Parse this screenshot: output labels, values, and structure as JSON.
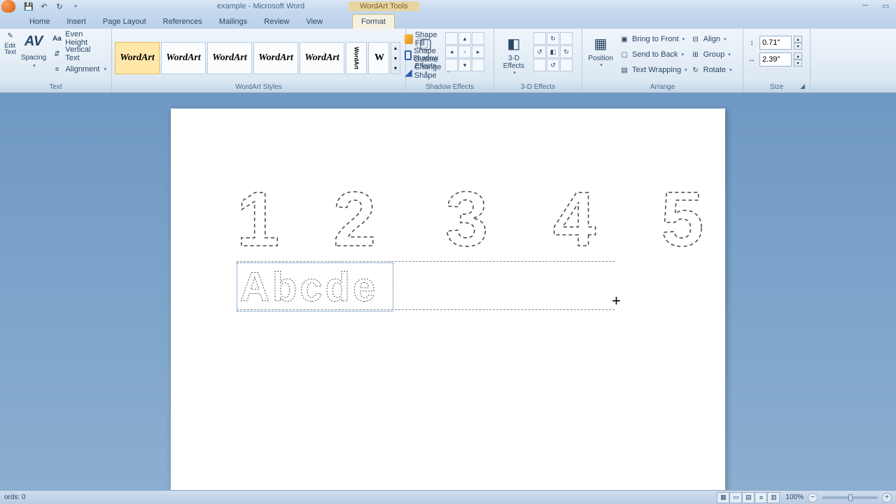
{
  "title": "example - Microsoft Word",
  "context_tab": "WordArt Tools",
  "tabs": [
    "Home",
    "Insert",
    "Page Layout",
    "References",
    "Mailings",
    "Review",
    "View",
    "Format"
  ],
  "ribbon": {
    "text": {
      "label": "Text",
      "edit": "Edit Text",
      "spacing": "Spacing",
      "even_height": "Even Height",
      "vertical_text": "Vertical Text",
      "alignment": "Alignment"
    },
    "styles": {
      "label": "WordArt Styles",
      "gallery": [
        "WordArt",
        "WordArt",
        "WordArt",
        "WordArt",
        "WordArt"
      ],
      "narrow": [
        "W",
        "W"
      ],
      "shape_fill": "Shape Fill",
      "shape_outline": "Shape Outline",
      "change_shape": "Change Shape"
    },
    "shadow": {
      "label": "Shadow Effects",
      "main": "Shadow Effects"
    },
    "threed": {
      "label": "3-D Effects",
      "main": "3-D Effects"
    },
    "arrange": {
      "label": "Arrange",
      "position": "Position",
      "bring_front": "Bring to Front",
      "send_back": "Send to Back",
      "text_wrap": "Text Wrapping",
      "align": "Align",
      "group": "Group",
      "rotate": "Rotate"
    },
    "size": {
      "label": "Size",
      "height": "0.71\"",
      "width": "2.39\""
    }
  },
  "document": {
    "numbers": [
      "1",
      "2",
      "3",
      "4",
      "5"
    ],
    "letters": "Abcde"
  },
  "status": {
    "words": "ords: 0",
    "zoom": "100%"
  }
}
